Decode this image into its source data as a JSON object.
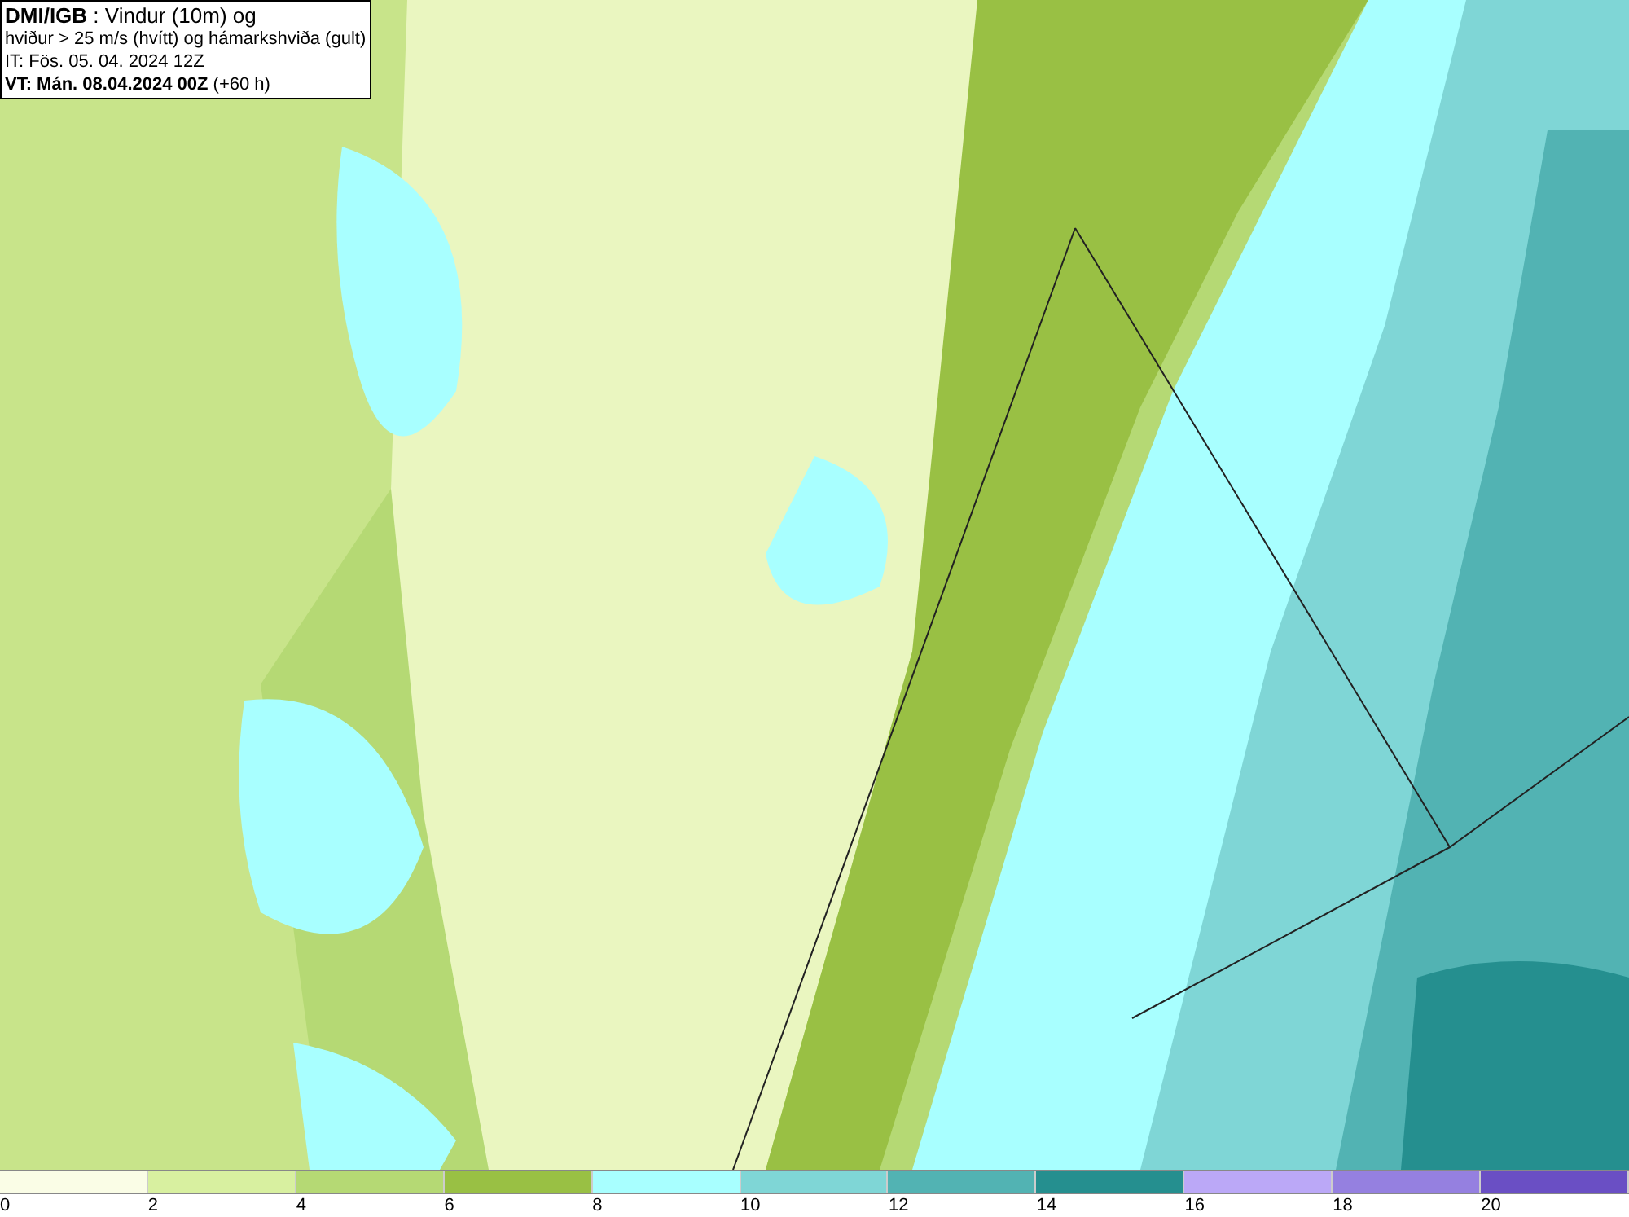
{
  "title_box": {
    "lines": [
      "**DMI/IGB** : Vindur (10m) og",
      "hviður > 25 m/s (hvítt) og hámarkshviða (gult)",
      "IT: Fös. 05. 04. 2024 12Z",
      "**VT: Mán. 08.04.2024 00Z** (+60 h)"
    ]
  },
  "legend": {
    "bins": [
      {
        "label": "0",
        "color": "#fafde6"
      },
      {
        "label": "2",
        "color": "#d8f0a0"
      },
      {
        "label": "4",
        "color": "#b5d974"
      },
      {
        "label": "6",
        "color": "#99c044"
      },
      {
        "label": "8",
        "color": "#a8ffff"
      },
      {
        "label": "10",
        "color": "#7fd6d6"
      },
      {
        "label": "12",
        "color": "#52b3b3"
      },
      {
        "label": "14",
        "color": "#258f8f"
      },
      {
        "label": "16",
        "color": "#bba8f7"
      },
      {
        "label": "18",
        "color": "#9580e0"
      },
      {
        "label": "20",
        "color": "#6a4fc4"
      }
    ]
  }
}
